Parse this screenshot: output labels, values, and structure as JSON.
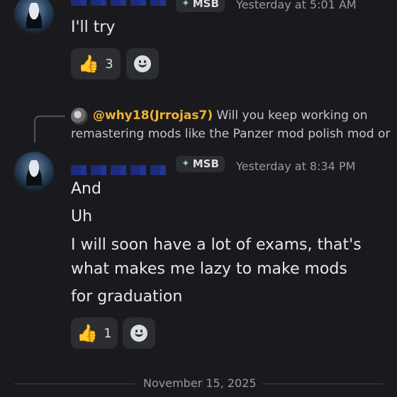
{
  "messages": [
    {
      "tag": "MSB",
      "timestamp": "Yesterday at 5:01 AM",
      "lines": [
        "I'll try"
      ],
      "reaction": {
        "emoji": "👍",
        "count": "3"
      }
    },
    {
      "reply": {
        "author": "@why18(Jrrojas7)",
        "preview_line1": "Will you keep working on",
        "preview_line2": "remastering mods like the Panzer mod polish mod or"
      },
      "tag": "MSB",
      "timestamp": "Yesterday at 8:34 PM",
      "lines": [
        "And",
        "Uh",
        "I will soon have a lot of exams, that's",
        "what makes me lazy to make mods",
        "for graduation"
      ],
      "reaction": {
        "emoji": "👍",
        "count": "1"
      }
    }
  ],
  "date_divider": "November 15, 2025",
  "icons": {
    "tag": "diamond-sparkle-icon",
    "add_reaction": "smiley-icon"
  }
}
